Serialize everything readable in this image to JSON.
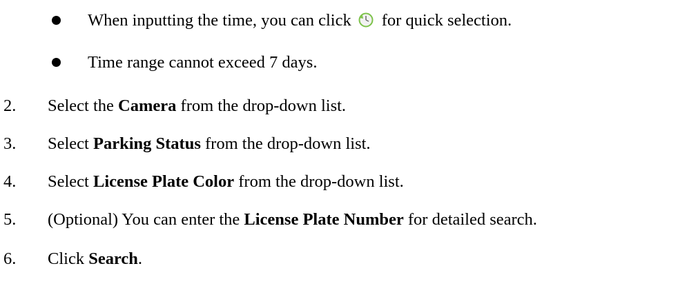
{
  "bullets": [
    {
      "before_icon": "When inputting the time, you can click",
      "icon": "time-picker-icon",
      "after_icon": "for quick selection."
    },
    {
      "text": "Time range cannot exceed 7 days."
    }
  ],
  "steps": [
    {
      "number": "2.",
      "pre": "Select the ",
      "bold": "Camera",
      "post": " from the drop-down list."
    },
    {
      "number": "3.",
      "pre": "Select ",
      "bold": "Parking Status",
      "post": " from the drop-down list."
    },
    {
      "number": "4.",
      "pre": "Select ",
      "bold": "License Plate Color",
      "post": " from the drop-down list."
    },
    {
      "number": "5.",
      "pre": "(Optional) You can enter the ",
      "bold": "License Plate Number",
      "post": " for detailed search."
    },
    {
      "number": "6.",
      "pre": "Click ",
      "bold": "Search",
      "post": "."
    }
  ],
  "colors": {
    "text": "#000000",
    "icon_green": "#7dc24a",
    "icon_face": "#f2f2f2"
  }
}
